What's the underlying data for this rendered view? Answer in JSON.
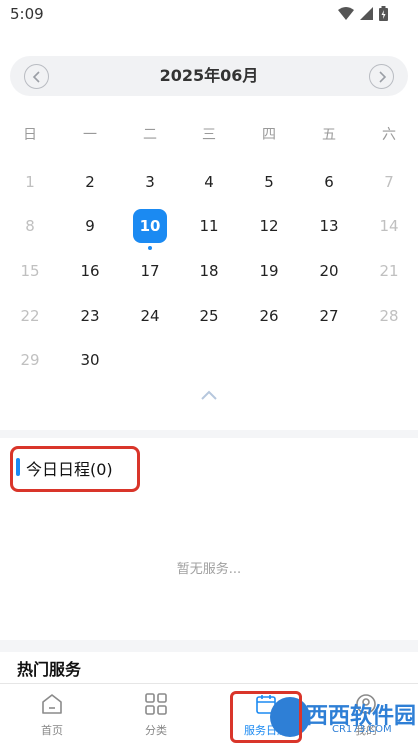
{
  "status_bar": {
    "time": "5:09"
  },
  "calendar": {
    "month_title": "2025年06月",
    "weekdays": [
      "日",
      "一",
      "二",
      "三",
      "四",
      "五",
      "六"
    ],
    "weeks": [
      [
        "1",
        "2",
        "3",
        "4",
        "5",
        "6",
        "7"
      ],
      [
        "8",
        "9",
        "10",
        "11",
        "12",
        "13",
        "14"
      ],
      [
        "15",
        "16",
        "17",
        "18",
        "19",
        "20",
        "21"
      ],
      [
        "22",
        "23",
        "24",
        "25",
        "26",
        "27",
        "28"
      ],
      [
        "29",
        "30"
      ]
    ],
    "selected_day": "10"
  },
  "today": {
    "title": "今日日程(0)",
    "empty_text": "暂无服务..."
  },
  "hot_services": {
    "title": "热门服务"
  },
  "tabbar": {
    "tabs": [
      {
        "label": "首页",
        "icon": "home-icon"
      },
      {
        "label": "分类",
        "icon": "grid-icon"
      },
      {
        "label": "服务日历",
        "icon": "calendar-icon"
      },
      {
        "label": "我的",
        "icon": "profile-icon"
      }
    ]
  },
  "watermark": {
    "text": "西西软件园",
    "sub": "CR173.COM"
  },
  "colors": {
    "accent": "#1b8af2",
    "highlight": "#d9352a"
  }
}
